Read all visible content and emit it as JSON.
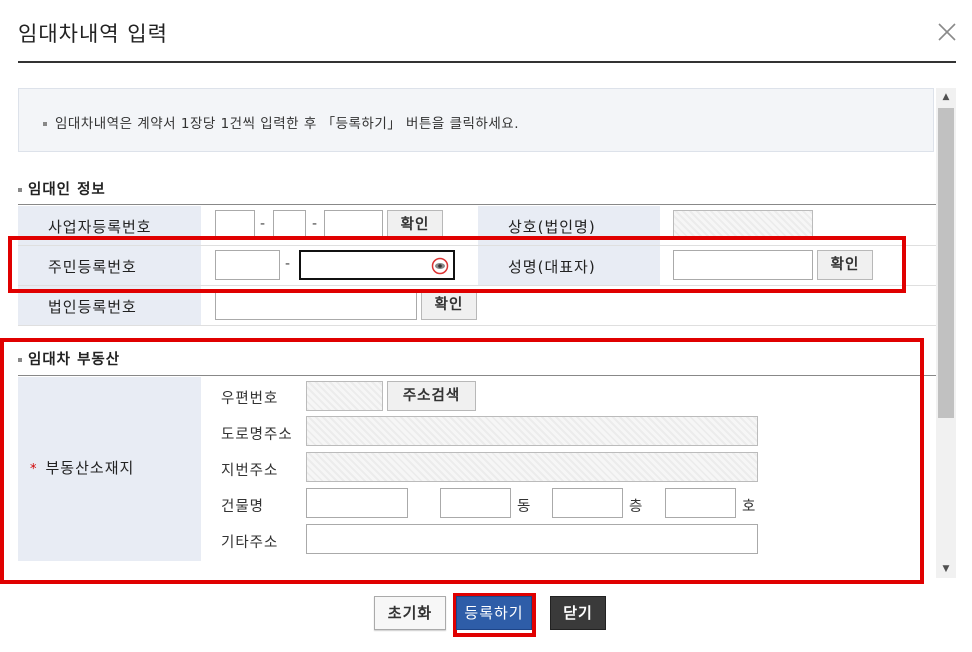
{
  "dialog": {
    "title": "임대차내역 입력"
  },
  "notice": {
    "text": "임대차내역은 계약서 1장당 1건씩 입력한 후 「등록하기」 버튼을 클릭하세요."
  },
  "lessor": {
    "section_title": "임대인 정보",
    "business_reg_label": "사업자등록번호",
    "confirm_label": "확인",
    "company_label": "상호(법인명)",
    "resident_reg_label": "주민등록번호",
    "name_label": "성명(대표자)",
    "corp_reg_label": "법인등록번호",
    "dash": "-"
  },
  "property": {
    "section_title": "임대차 부동산",
    "location_label": "부동산소재지",
    "required_mark": "*",
    "zip_label": "우편번호",
    "address_search_label": "주소검색",
    "road_address_label": "도로명주소",
    "lot_address_label": "지번주소",
    "building_label": "건물명",
    "dong_unit": "동",
    "floor_unit": "층",
    "ho_unit": "호",
    "other_address_label": "기타주소"
  },
  "footer": {
    "reset_label": "초기화",
    "register_label": "등록하기",
    "close_label": "닫기"
  },
  "colors": {
    "highlight_box": "#e00000",
    "primary_button": "#2e5da8",
    "dark_button": "#3a3a3a",
    "label_bg": "#e8ecf4"
  }
}
